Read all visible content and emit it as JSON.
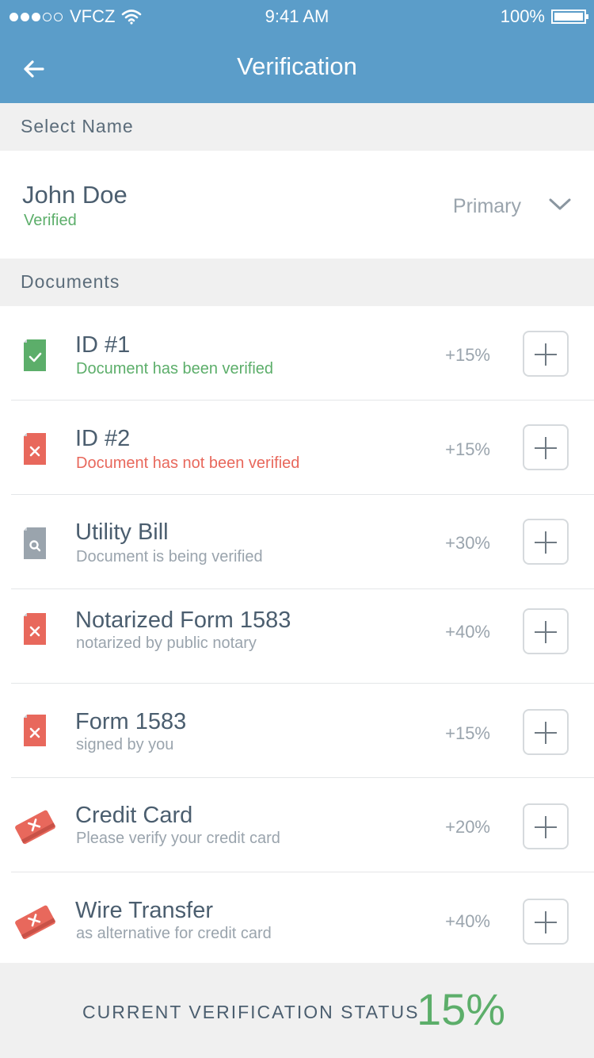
{
  "status_bar": {
    "carrier": "VFCZ",
    "time": "9:41 AM",
    "battery": "100%"
  },
  "nav": {
    "title": "Verification"
  },
  "select_name": {
    "header": "Select Name",
    "name": "John Doe",
    "status": "Verified",
    "type": "Primary"
  },
  "documents": {
    "header": "Documents",
    "items": [
      {
        "title": "ID #1",
        "subtitle": "Document has been verified",
        "percent": "+15%",
        "state": "verified",
        "icon": "document-verified-icon"
      },
      {
        "title": "ID #2",
        "subtitle": "Document has not been verified",
        "percent": "+15%",
        "state": "rejected",
        "icon": "document-rejected-icon"
      },
      {
        "title": "Utility Bill",
        "subtitle": "Document is being verified",
        "percent": "+30%",
        "state": "pending",
        "icon": "document-search-icon"
      },
      {
        "title": "Notarized Form 1583",
        "subtitle": "notarized by public notary",
        "percent": "+40%",
        "state": "missing",
        "icon": "document-rejected-icon"
      },
      {
        "title": "Form 1583",
        "subtitle": "signed by you",
        "percent": "+15%",
        "state": "missing",
        "icon": "document-rejected-icon"
      },
      {
        "title": "Credit Card",
        "subtitle": "Please verify your credit card",
        "percent": "+20%",
        "state": "missing",
        "icon": "card-rejected-icon"
      },
      {
        "title": "Wire Transfer",
        "subtitle": "as alternative for credit card",
        "percent": "+40%",
        "state": "missing",
        "icon": "card-rejected-icon"
      }
    ]
  },
  "footer": {
    "label": "CURRENT VERIFICATION STATUS",
    "value": "15%"
  },
  "colors": {
    "header_blue": "#5b9dc9",
    "green": "#5cae6a",
    "red": "#e8685c",
    "gray": "#9aa4ad",
    "text": "#4b5e6f"
  }
}
